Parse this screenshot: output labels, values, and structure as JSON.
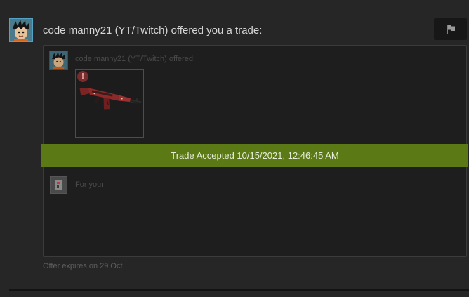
{
  "trade_offer": {
    "title": "code manny21 (YT/Twitch) offered you a trade:",
    "offered_label": "code manny21 (YT/Twitch) offered:",
    "status_banner": "Trade Accepted 10/15/2021, 12:46:45 AM",
    "for_label": "For your:",
    "expiry_note": "Offer expires on 29 Oct",
    "item_warning_glyph": "!",
    "icons": {
      "flag": "flag-icon",
      "warning": "warning-icon",
      "item": "ak47-rifle-icon"
    },
    "colors": {
      "accepted_banner": "#5b7a15",
      "avatar_border": "#53a4c4"
    }
  }
}
